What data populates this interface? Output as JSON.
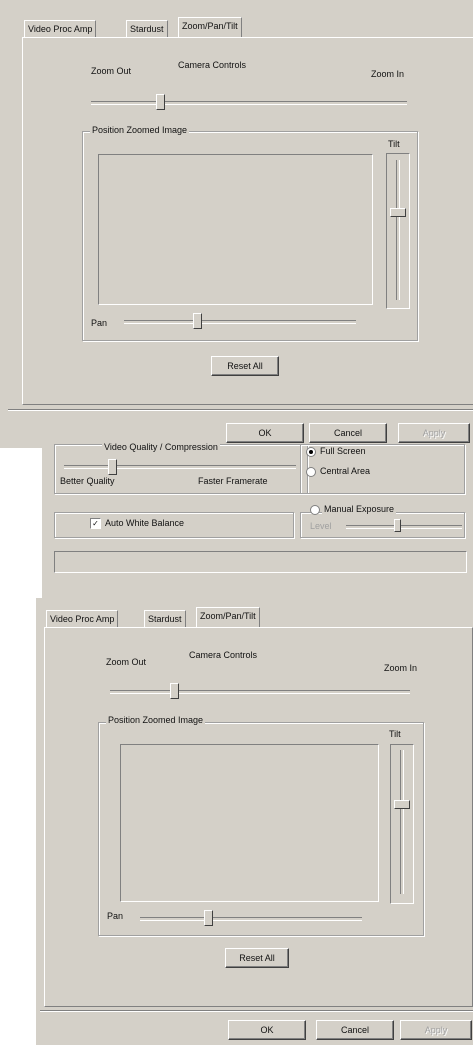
{
  "dialog1": {
    "tabs": [
      "Video Proc Amp",
      "Stardust",
      "Zoom/Pan/Tilt"
    ],
    "camera_controls": "Camera Controls",
    "zoom_out": "Zoom Out",
    "zoom_in": "Zoom In",
    "position_group": "Position Zoomed Image",
    "tilt": "Tilt",
    "pan": "Pan",
    "reset_all": "Reset All",
    "ok": "OK",
    "cancel": "Cancel",
    "apply": "Apply"
  },
  "middle": {
    "quality_label": "Video Quality / Compression",
    "better_quality": "Better Quality",
    "faster_framerate": "Faster Framerate",
    "full_screen": "Full Screen",
    "central_area": "Central Area",
    "auto_white_balance": "Auto White Balance",
    "auto_white_balance_checked": true,
    "manual_exposure": "Manual Exposure",
    "level": "Level"
  },
  "dialog2": {
    "tabs": [
      "Video Proc Amp",
      "Stardust",
      "Zoom/Pan/Tilt"
    ],
    "camera_controls": "Camera Controls",
    "zoom_out": "Zoom Out",
    "zoom_in": "Zoom In",
    "position_group": "Position Zoomed Image",
    "tilt": "Tilt",
    "pan": "Pan",
    "reset_all": "Reset All",
    "ok": "OK",
    "cancel": "Cancel",
    "apply": "Apply"
  }
}
